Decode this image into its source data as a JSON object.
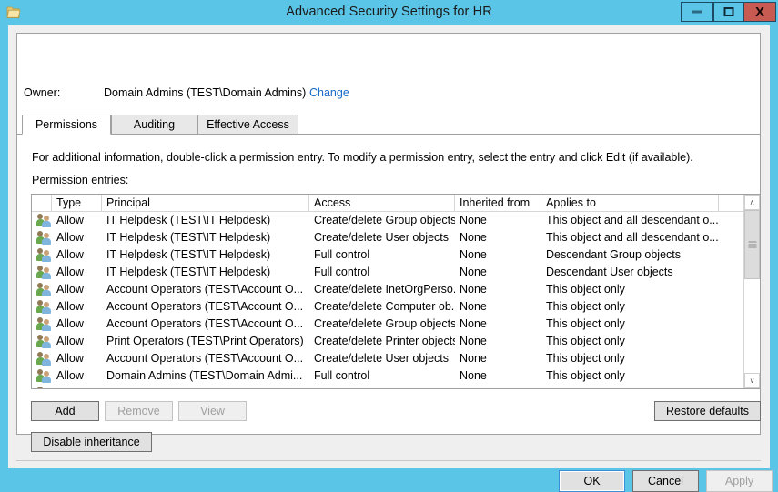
{
  "window": {
    "title": "Advanced Security Settings for HR",
    "app_icon": "folder-icon",
    "titlebar_color": "#5bc5e8",
    "close_color": "#c75b52",
    "caption": {
      "minimize_label": "–",
      "maximize_label": "□",
      "close_label": "X"
    }
  },
  "owner": {
    "label": "Owner:",
    "value": "Domain Admins (TEST\\Domain Admins)",
    "change_link": "Change",
    "link_color": "#1569c7"
  },
  "tabs": [
    {
      "label": "Permissions",
      "active": true
    },
    {
      "label": "Auditing",
      "active": false
    },
    {
      "label": "Effective Access",
      "active": false
    }
  ],
  "info_text": "For additional information, double-click a permission entry. To modify a permission entry, select the entry and click Edit (if available).",
  "entries_label": "Permission entries:",
  "table": {
    "columns": [
      "",
      "Type",
      "Principal",
      "Access",
      "Inherited from",
      "Applies to"
    ],
    "rows": [
      {
        "icon": "user-group-icon",
        "type": "Allow",
        "principal": "IT Helpdesk (TEST\\IT Helpdesk)",
        "access": "Create/delete Group objects",
        "inherited_from": "None",
        "applies_to": "This object and all descendant o..."
      },
      {
        "icon": "user-group-icon",
        "type": "Allow",
        "principal": "IT Helpdesk (TEST\\IT Helpdesk)",
        "access": "Create/delete User objects",
        "inherited_from": "None",
        "applies_to": "This object and all descendant o..."
      },
      {
        "icon": "user-group-icon",
        "type": "Allow",
        "principal": "IT Helpdesk (TEST\\IT Helpdesk)",
        "access": "Full control",
        "inherited_from": "None",
        "applies_to": "Descendant Group objects"
      },
      {
        "icon": "user-group-icon",
        "type": "Allow",
        "principal": "IT Helpdesk (TEST\\IT Helpdesk)",
        "access": "Full control",
        "inherited_from": "None",
        "applies_to": "Descendant User objects"
      },
      {
        "icon": "user-group-icon",
        "type": "Allow",
        "principal": "Account Operators (TEST\\Account O...",
        "access": "Create/delete InetOrgPerso...",
        "inherited_from": "None",
        "applies_to": "This object only"
      },
      {
        "icon": "user-group-icon",
        "type": "Allow",
        "principal": "Account Operators (TEST\\Account O...",
        "access": "Create/delete Computer ob...",
        "inherited_from": "None",
        "applies_to": "This object only"
      },
      {
        "icon": "user-group-icon",
        "type": "Allow",
        "principal": "Account Operators (TEST\\Account O...",
        "access": "Create/delete Group objects",
        "inherited_from": "None",
        "applies_to": "This object only"
      },
      {
        "icon": "user-group-icon",
        "type": "Allow",
        "principal": "Print Operators (TEST\\Print Operators)",
        "access": "Create/delete Printer objects",
        "inherited_from": "None",
        "applies_to": "This object only"
      },
      {
        "icon": "user-group-icon",
        "type": "Allow",
        "principal": "Account Operators (TEST\\Account O...",
        "access": "Create/delete User objects",
        "inherited_from": "None",
        "applies_to": "This object only"
      },
      {
        "icon": "user-group-icon",
        "type": "Allow",
        "principal": "Domain Admins (TEST\\Domain Admi...",
        "access": "Full control",
        "inherited_from": "None",
        "applies_to": "This object only"
      },
      {
        "icon": "user-group-icon",
        "type": "",
        "principal": "",
        "access": "",
        "inherited_from": "",
        "applies_to": ""
      }
    ]
  },
  "scrollbar": {
    "up_arrow": "∧",
    "down_arrow": "∨"
  },
  "buttons": {
    "add": {
      "label": "Add",
      "enabled": true
    },
    "remove": {
      "label": "Remove",
      "enabled": false
    },
    "view": {
      "label": "View",
      "enabled": false
    },
    "restore_defaults": {
      "label": "Restore defaults",
      "enabled": true
    },
    "disable_inheritance": {
      "label": "Disable inheritance",
      "enabled": true
    }
  },
  "footer": {
    "ok": {
      "label": "OK",
      "enabled": true,
      "focused": true
    },
    "cancel": {
      "label": "Cancel",
      "enabled": true
    },
    "apply": {
      "label": "Apply",
      "enabled": false
    }
  }
}
